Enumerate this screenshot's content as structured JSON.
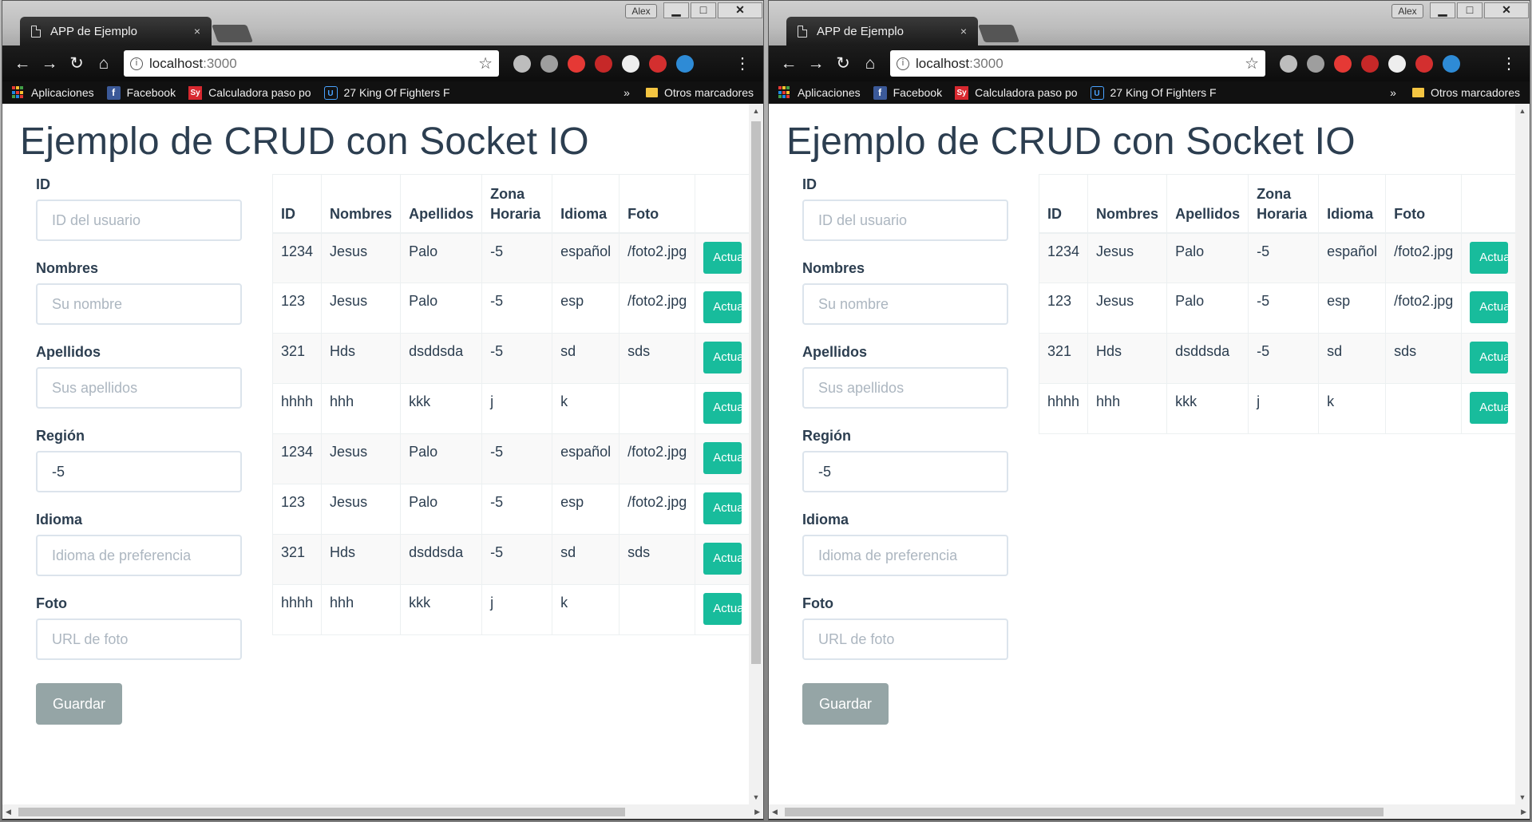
{
  "browser": {
    "tab_title": "APP de Ejemplo",
    "tab_close": "×",
    "user_label": "Alex",
    "win_min": "▁",
    "win_max": "□",
    "win_close": "✕",
    "nav_back": "←",
    "nav_forward": "→",
    "nav_reload": "↻",
    "nav_home": "⌂",
    "url_host": "localhost",
    "url_port": ":3000",
    "info_icon": "i",
    "star_icon": "☆",
    "menu_icon": "⋮",
    "extension_icons": [
      "speed-dial-icon",
      "drive-icon",
      "shield-red-icon",
      "ghost-icon",
      "cube-icon",
      "pocket-icon",
      "globe-icon"
    ],
    "extension_colors": [
      "#bdbdbd",
      "#9e9e9e",
      "#e53935",
      "#c62828",
      "#eeeeee",
      "#d32f2f",
      "#2e8bd6"
    ],
    "bookmarks": {
      "apps": "Aplicaciones",
      "facebook": "Facebook",
      "facebook_icon_text": "f",
      "calculadora": "Calculadora paso po",
      "calculadora_icon_text": "Sy",
      "kof": "27 King Of Fighters F",
      "kof_icon_text": "U",
      "more": "»",
      "otros": "Otros marcadores"
    }
  },
  "page": {
    "title": "Ejemplo de CRUD con Socket IO",
    "form": {
      "id_label": "ID",
      "id_placeholder": "ID del usuario",
      "nombres_label": "Nombres",
      "nombres_placeholder": "Su nombre",
      "apellidos_label": "Apellidos",
      "apellidos_placeholder": "Sus apellidos",
      "region_label": "Región",
      "region_value": "-5",
      "idioma_label": "Idioma",
      "idioma_placeholder": "Idioma de preferencia",
      "foto_label": "Foto",
      "foto_placeholder": "URL de foto",
      "save_button": "Guardar"
    },
    "table": {
      "headers": [
        "ID",
        "Nombres",
        "Apellidos",
        "Zona Horaria",
        "Idioma",
        "Foto"
      ],
      "action_label": "Actualizar"
    }
  },
  "left_window": {
    "rows": [
      [
        "1234",
        "Jesus",
        "Palo",
        "-5",
        "español",
        "/foto2.jpg"
      ],
      [
        "123",
        "Jesus",
        "Palo",
        "-5",
        "esp",
        "/foto2.jpg"
      ],
      [
        "321",
        "Hds",
        "dsddsda",
        "-5",
        "sd",
        "sds"
      ],
      [
        "hhhh",
        "hhh",
        "kkk",
        "j",
        "k",
        ""
      ],
      [
        "1234",
        "Jesus",
        "Palo",
        "-5",
        "español",
        "/foto2.jpg"
      ],
      [
        "123",
        "Jesus",
        "Palo",
        "-5",
        "esp",
        "/foto2.jpg"
      ],
      [
        "321",
        "Hds",
        "dsddsda",
        "-5",
        "sd",
        "sds"
      ],
      [
        "hhhh",
        "hhh",
        "kkk",
        "j",
        "k",
        ""
      ]
    ]
  },
  "right_window": {
    "rows": [
      [
        "1234",
        "Jesus",
        "Palo",
        "-5",
        "español",
        "/foto2.jpg"
      ],
      [
        "123",
        "Jesus",
        "Palo",
        "-5",
        "esp",
        "/foto2.jpg"
      ],
      [
        "321",
        "Hds",
        "dsddsda",
        "-5",
        "sd",
        "sds"
      ],
      [
        "hhhh",
        "hhh",
        "kkk",
        "j",
        "k",
        ""
      ]
    ]
  }
}
